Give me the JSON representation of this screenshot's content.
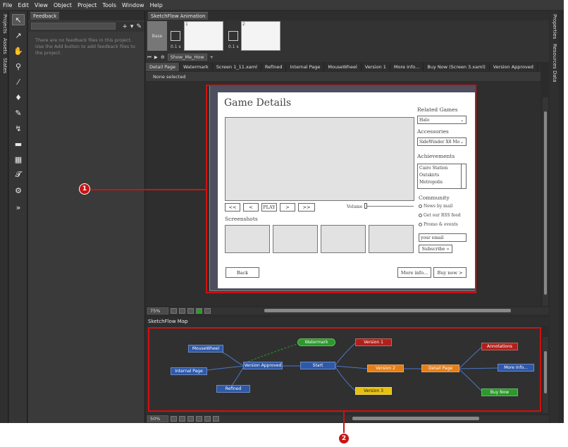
{
  "menu": [
    "File",
    "Edit",
    "View",
    "Object",
    "Project",
    "Tools",
    "Window",
    "Help"
  ],
  "left_tabs": [
    "Projects",
    "Assets",
    "States"
  ],
  "right_tabs": [
    "Properties",
    "Resources",
    "Data"
  ],
  "feedback": {
    "title": "Feedback",
    "empty_message": "There are no feedback files in this project. Use the Add button to add feedback files to the project."
  },
  "animation": {
    "title": "SketchFlow Animation",
    "base_label": "Base",
    "frames": [
      {
        "num": "1",
        "duration": "0.1 s"
      },
      {
        "num": "2",
        "duration": "0.1 s"
      }
    ],
    "name": "Show_Me_How"
  },
  "doc_tabs": [
    "Detail Page",
    "Watermark",
    "Screen 1_11.xaml",
    "Refined",
    "Internal Page",
    "MouseWheel",
    "Version 1",
    "More info...",
    "Buy Now (Screen 3.xaml)",
    "Version Approved"
  ],
  "selection_status": "None selected",
  "mockup": {
    "title": "Game Details",
    "buttons": [
      "<<",
      "<",
      "PLAY",
      ">",
      ">>"
    ],
    "volume_label": "Volume",
    "screenshots_label": "Screenshots",
    "related_games_label": "Related Games",
    "related_games_value": "Halo",
    "accessories_label": "Accessories",
    "accessories_value": "SideWinder X8 Mo",
    "achievements_label": "Achievements",
    "achievements": [
      "Cairo Station",
      "Outskirts",
      "Metropolis"
    ],
    "community_label": "Community",
    "community_options": [
      "News by mail",
      "Get our RSS feed",
      "Promo & events"
    ],
    "email_placeholder": "your email",
    "subscribe_label": "Subscribe »",
    "back_label": "Back",
    "more_info_label": "More info...",
    "buy_now_label": "Buy now >"
  },
  "artboard_zoom": "75%",
  "map": {
    "title": "SketchFlow Map",
    "zoom": "50%",
    "nodes": [
      "MouseWheel",
      "Internal Page",
      "Version Approved",
      "Refined",
      "Watermark",
      "Start",
      "Version 1",
      "Version 2",
      "Version 3",
      "Detail Page",
      "Annotations",
      "More Info...",
      "Buy Now"
    ]
  },
  "callouts": [
    "1",
    "2"
  ],
  "colors": {
    "accent_red": "#c81414",
    "node_blue": "#2e58a8",
    "node_orange": "#e67e16",
    "node_red": "#b0201a",
    "node_green": "#2a9a2a",
    "node_yellow": "#e8c010"
  }
}
